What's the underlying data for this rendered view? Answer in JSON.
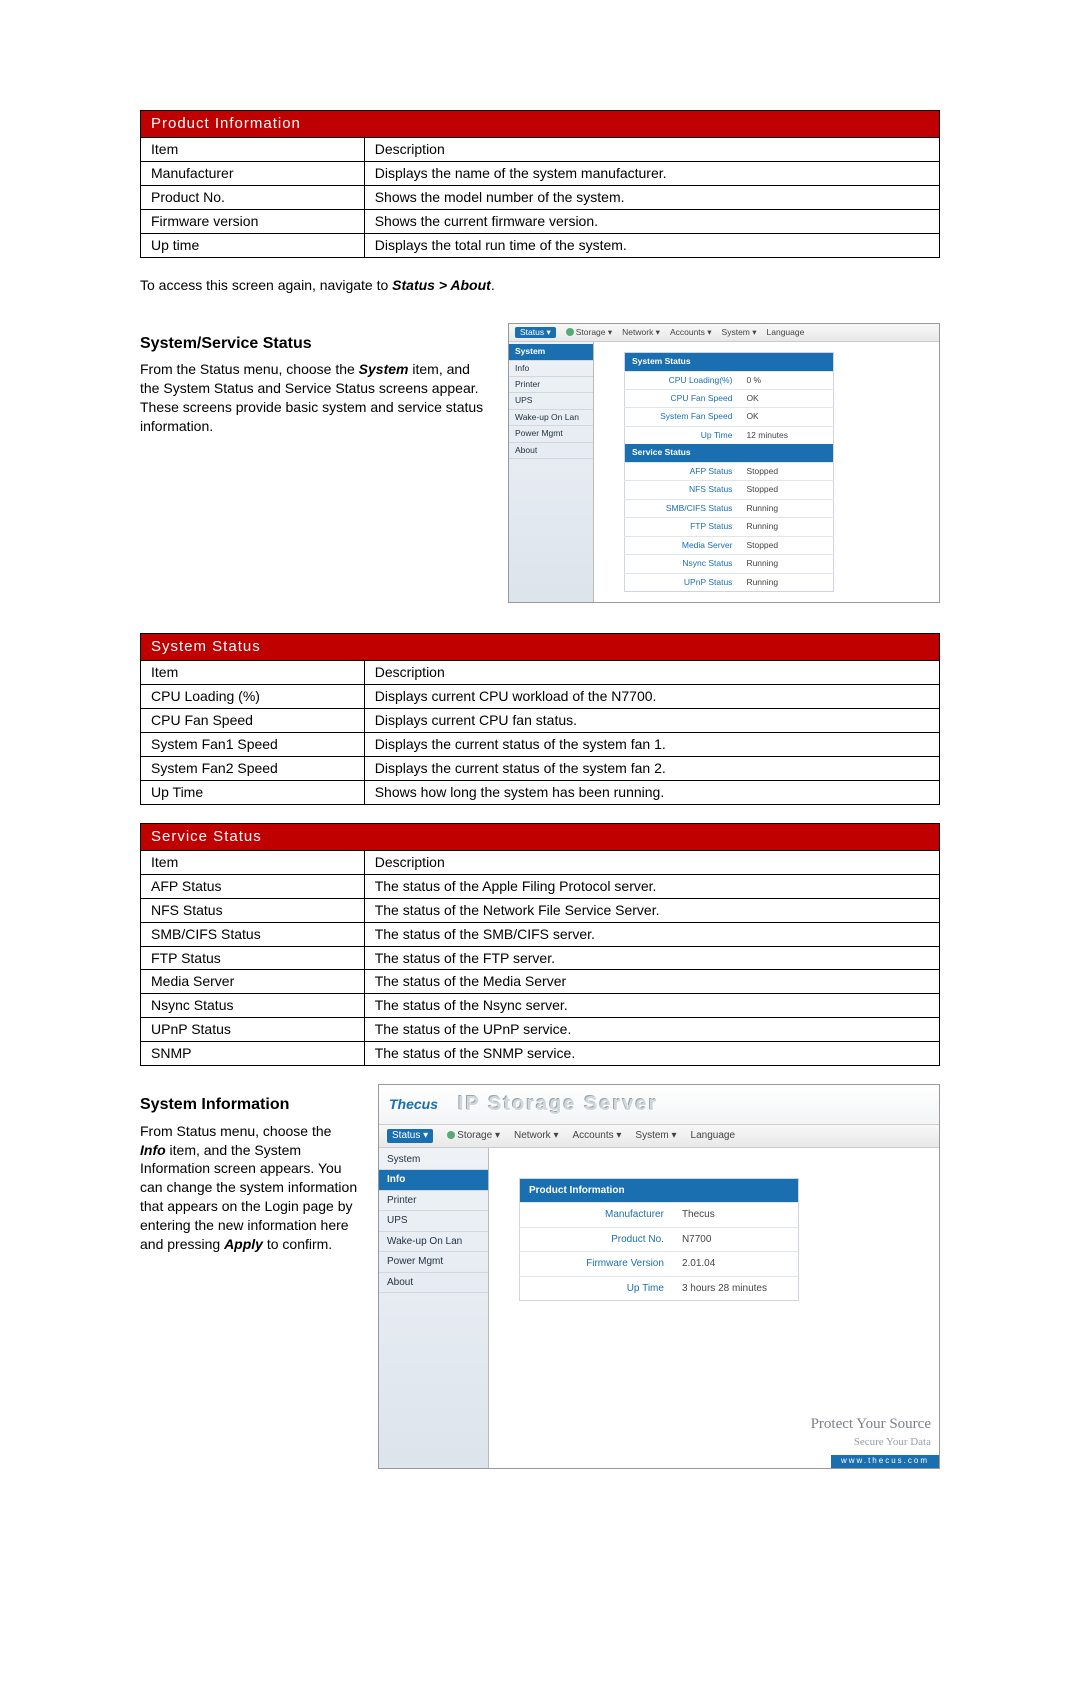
{
  "product_info_table": {
    "title": "Product Information",
    "head_item": "Item",
    "head_desc": "Description",
    "rows": [
      {
        "item": "Manufacturer",
        "desc": "Displays the name of the system manufacturer."
      },
      {
        "item": "Product No.",
        "desc": "Shows the model number of the system."
      },
      {
        "item": "Firmware version",
        "desc": "Shows the current firmware version."
      },
      {
        "item": "Up time",
        "desc": "Displays the total run time of the system."
      }
    ]
  },
  "nav_note": {
    "prefix": "To access this screen again, navigate to ",
    "crumb": "Status > About",
    "suffix": "."
  },
  "sect_system_service": {
    "heading": "System/Service Status",
    "para_parts": [
      "From the Status menu, choose the ",
      "System",
      " item, and the System Status and Service Status screens appear. These screens provide basic system and service status information."
    ]
  },
  "shot1": {
    "menubar": [
      "Status ▾",
      "Storage ▾",
      "Network ▾",
      "Accounts ▾",
      "System ▾",
      "Language"
    ],
    "sidebar": [
      "System",
      "Info",
      "Printer",
      "UPS",
      "Wake-up On Lan",
      "Power Mgmt",
      "About"
    ],
    "sidebar_active_idx": 0,
    "system_status_title": "System Status",
    "system_status_rows": [
      {
        "k": "CPU Loading(%)",
        "v": "0 %"
      },
      {
        "k": "CPU Fan Speed",
        "v": "OK"
      },
      {
        "k": "System Fan Speed",
        "v": "OK"
      },
      {
        "k": "Up Time",
        "v": "12 minutes"
      }
    ],
    "service_status_title": "Service Status",
    "service_status_rows": [
      {
        "k": "AFP Status",
        "v": "Stopped"
      },
      {
        "k": "NFS Status",
        "v": "Stopped"
      },
      {
        "k": "SMB/CIFS Status",
        "v": "Running"
      },
      {
        "k": "FTP Status",
        "v": "Running"
      },
      {
        "k": "Media Server",
        "v": "Stopped"
      },
      {
        "k": "Nsync Status",
        "v": "Running"
      },
      {
        "k": "UPnP Status",
        "v": "Running"
      }
    ]
  },
  "system_status_table": {
    "title": "System Status",
    "head_item": "Item",
    "head_desc": "Description",
    "rows": [
      {
        "item": "CPU Loading (%)",
        "desc": "Displays current CPU workload of the N7700."
      },
      {
        "item": "CPU Fan Speed",
        "desc": "Displays current CPU fan status."
      },
      {
        "item": "System Fan1 Speed",
        "desc": "Displays the current status of the system fan 1."
      },
      {
        "item": "System Fan2 Speed",
        "desc": "Displays the current status of the system fan 2."
      },
      {
        "item": "Up Time",
        "desc": "Shows how long the system has been running."
      }
    ]
  },
  "service_status_table": {
    "title": "Service Status",
    "head_item": "Item",
    "head_desc": "Description",
    "rows": [
      {
        "item": "AFP Status",
        "desc": "The status of the Apple Filing Protocol server."
      },
      {
        "item": "NFS Status",
        "desc": "The status of the Network File Service Server."
      },
      {
        "item": "SMB/CIFS Status",
        "desc": "The status of the SMB/CIFS server."
      },
      {
        "item": "FTP Status",
        "desc": "The status of the FTP server."
      },
      {
        "item": "Media Server",
        "desc": "The status of the Media Server"
      },
      {
        "item": "Nsync Status",
        "desc": "The status of the Nsync server."
      },
      {
        "item": "UPnP Status",
        "desc": "The status of the UPnP service."
      },
      {
        "item": "SNMP",
        "desc": "The status of the SNMP service."
      }
    ]
  },
  "sect_system_info": {
    "heading": "System Information",
    "para_parts": [
      "From Status menu, choose the ",
      "Info",
      " item, and the System Information screen appears. You can change the system information that appears on the Login page by entering the new information here and pressing ",
      "Apply",
      " to confirm."
    ]
  },
  "shot2": {
    "brand": "Thecus",
    "title": "IP Storage Server",
    "menubar": [
      "Status ▾",
      "Storage ▾",
      "Network ▾",
      "Accounts ▾",
      "System ▾",
      "Language"
    ],
    "sidebar": [
      "System",
      "Info",
      "Printer",
      "UPS",
      "Wake-up On Lan",
      "Power Mgmt",
      "About"
    ],
    "sidebar_active_idx": 1,
    "panel_title": "Product Information",
    "rows": [
      {
        "k": "Manufacturer",
        "v": "Thecus"
      },
      {
        "k": "Product No.",
        "v": "N7700"
      },
      {
        "k": "Firmware Version",
        "v": "2.01.04"
      },
      {
        "k": "Up Time",
        "v": "3 hours 28 minutes"
      }
    ],
    "footer1": "Protect Your Source",
    "footer2": "Secure Your Data",
    "footer_url": "www.thecus.com"
  }
}
